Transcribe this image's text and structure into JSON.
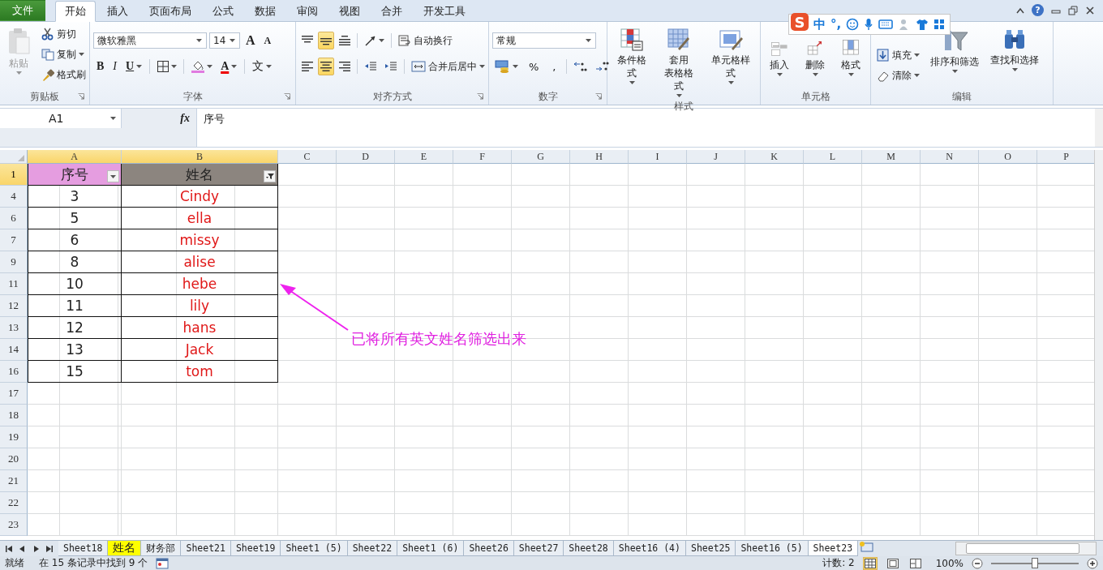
{
  "tabs": [
    {
      "label": "文件",
      "kind": "file",
      "selected": false
    },
    {
      "label": "开始",
      "kind": "tab",
      "selected": true
    },
    {
      "label": "插入",
      "kind": "tab",
      "selected": false
    },
    {
      "label": "页面布局",
      "kind": "tab",
      "selected": false
    },
    {
      "label": "公式",
      "kind": "tab",
      "selected": false
    },
    {
      "label": "数据",
      "kind": "tab",
      "selected": false
    },
    {
      "label": "审阅",
      "kind": "tab",
      "selected": false
    },
    {
      "label": "视图",
      "kind": "tab",
      "selected": false
    },
    {
      "label": "合并",
      "kind": "tab",
      "selected": false
    },
    {
      "label": "开发工具",
      "kind": "tab",
      "selected": false
    }
  ],
  "help_label": "?",
  "ime_bar": {
    "logo": "S",
    "mode": "中",
    "punct": "°,"
  },
  "ribbon": [
    {
      "title": "剪贴板",
      "stacks": [
        [
          {
            "kind": "paste",
            "label": "粘贴",
            "disabled": true
          }
        ],
        [
          {
            "kind": "cut",
            "label": "剪切"
          },
          {
            "kind": "copy",
            "label": "复制"
          },
          {
            "kind": "painter",
            "label": "格式刷"
          }
        ]
      ]
    },
    {
      "title": "字体",
      "lines": [
        [
          {
            "kind": "font",
            "value": "微软雅黑"
          },
          {
            "kind": "size",
            "value": "14"
          },
          {
            "kind": "grow",
            "label": "A"
          },
          {
            "kind": "shrink",
            "label": "A"
          }
        ],
        [
          {
            "kind": "bold",
            "label": "B"
          },
          {
            "kind": "italic",
            "label": "I"
          },
          {
            "kind": "underline",
            "label": "U"
          },
          {
            "kind": "sep"
          },
          {
            "kind": "borders"
          },
          {
            "kind": "sep"
          },
          {
            "kind": "fillcolor"
          },
          {
            "kind": "fontcolor",
            "label": "A"
          },
          {
            "kind": "sep"
          },
          {
            "kind": "phonetic",
            "label": "文"
          }
        ]
      ]
    },
    {
      "title": "对齐方式",
      "lines": [
        [
          {
            "kind": "top",
            "selected": false
          },
          {
            "kind": "middle",
            "selected": true
          },
          {
            "kind": "bottom",
            "selected": false
          },
          {
            "kind": "sep"
          },
          {
            "kind": "orient"
          },
          {
            "kind": "sep"
          },
          {
            "kind": "wrap",
            "label": "自动换行"
          }
        ],
        [
          {
            "kind": "left",
            "selected": false
          },
          {
            "kind": "center",
            "selected": true
          },
          {
            "kind": "right",
            "selected": false
          },
          {
            "kind": "sep"
          },
          {
            "kind": "outdent"
          },
          {
            "kind": "indent"
          },
          {
            "kind": "sep"
          },
          {
            "kind": "merge",
            "label": "合并后居中"
          }
        ]
      ]
    },
    {
      "title": "数字",
      "lines": [
        [
          {
            "kind": "format",
            "value": "常规"
          }
        ],
        [
          {
            "kind": "currency"
          },
          {
            "kind": "percent",
            "label": "%"
          },
          {
            "kind": "comma",
            "label": ","
          },
          {
            "kind": "sep"
          },
          {
            "kind": "incdec"
          },
          {
            "kind": "decdec"
          }
        ]
      ]
    },
    {
      "title": "样式",
      "stacks": [
        [
          {
            "kind": "conditional",
            "label": "条件格式"
          }
        ],
        [
          {
            "kind": "table",
            "label": [
              "套用",
              "表格格式"
            ]
          }
        ],
        [
          {
            "kind": "cellstyle",
            "label": "单元格样式"
          }
        ]
      ]
    },
    {
      "title": "单元格",
      "stacks": [
        [
          {
            "kind": "insert",
            "label": "插入"
          }
        ],
        [
          {
            "kind": "delete",
            "label": "删除"
          }
        ],
        [
          {
            "kind": "cellformat",
            "label": "格式"
          }
        ]
      ]
    },
    {
      "title": "编辑",
      "stacks": [
        [
          {
            "kind": "fill",
            "label": "填充"
          },
          {
            "kind": "clear",
            "label": "清除"
          }
        ],
        [
          {
            "kind": "sort",
            "label": "排序和筛选"
          }
        ],
        [
          {
            "kind": "find",
            "label": "查找和选择"
          }
        ]
      ]
    }
  ],
  "formula_bar": {
    "name_box": "A1",
    "function_label": "fx",
    "formula": "序号"
  },
  "sheet": {
    "columns": [
      {
        "label": "A",
        "selected": true
      },
      {
        "label": "B",
        "selected": true
      },
      {
        "label": "C",
        "selected": false
      },
      {
        "label": "D",
        "selected": false
      },
      {
        "label": "E",
        "selected": false
      },
      {
        "label": "F",
        "selected": false
      },
      {
        "label": "G",
        "selected": false
      },
      {
        "label": "H",
        "selected": false
      },
      {
        "label": "I",
        "selected": false
      },
      {
        "label": "J",
        "selected": false
      },
      {
        "label": "K",
        "selected": false
      },
      {
        "label": "L",
        "selected": false
      },
      {
        "label": "M",
        "selected": false
      },
      {
        "label": "N",
        "selected": false
      },
      {
        "label": "O",
        "selected": false
      },
      {
        "label": "P",
        "selected": false
      }
    ],
    "header_row": {
      "number": "1",
      "selected": true,
      "cells": [
        {
          "text": "序号",
          "color": "#e59de0",
          "filtered": false
        },
        {
          "text": "姓名",
          "color": "#8c857f",
          "filtered": true
        }
      ]
    },
    "rows": [
      {
        "number": "4",
        "cells": [
          "3",
          "Cindy"
        ]
      },
      {
        "number": "6",
        "cells": [
          "5",
          "ella"
        ]
      },
      {
        "number": "7",
        "cells": [
          "6",
          "missy"
        ]
      },
      {
        "number": "9",
        "cells": [
          "8",
          "alise"
        ]
      },
      {
        "number": "11",
        "cells": [
          "10",
          "hebe"
        ]
      },
      {
        "number": "12",
        "cells": [
          "11",
          "lily"
        ]
      },
      {
        "number": "13",
        "cells": [
          "12",
          "hans"
        ]
      },
      {
        "number": "14",
        "cells": [
          "13",
          "Jack"
        ]
      },
      {
        "number": "16",
        "cells": [
          "15",
          "tom"
        ]
      }
    ],
    "empty_rows": [
      "17",
      "18",
      "19",
      "20",
      "21",
      "22",
      "23"
    ]
  },
  "annotation": {
    "text": "已将所有英文姓名筛选出来"
  },
  "sheet_tabs": [
    {
      "label": "Sheet18",
      "selected": false
    },
    {
      "label": "姓名",
      "selected": false,
      "color": "#ffff00"
    },
    {
      "label": "财务部",
      "selected": false
    },
    {
      "label": "Sheet21",
      "selected": false
    },
    {
      "label": "Sheet19",
      "selected": false
    },
    {
      "label": "Sheet1 (5)",
      "selected": false
    },
    {
      "label": "Sheet22",
      "selected": false
    },
    {
      "label": "Sheet1 (6)",
      "selected": false
    },
    {
      "label": "Sheet26",
      "selected": false
    },
    {
      "label": "Sheet27",
      "selected": false
    },
    {
      "label": "Sheet28",
      "selected": false
    },
    {
      "label": "Sheet16 (4)",
      "selected": false
    },
    {
      "label": "Sheet25",
      "selected": false
    },
    {
      "label": "Sheet16 (5)",
      "selected": false
    },
    {
      "label": "Sheet23",
      "selected": true
    }
  ],
  "status_bar": {
    "ready": "就绪",
    "filter_info": "在 15 条记录中找到 9 个",
    "count": "计数: 2",
    "views": [
      {
        "kind": "normal",
        "selected": true
      },
      {
        "kind": "page",
        "selected": false
      },
      {
        "kind": "break",
        "selected": false
      }
    ],
    "zoom": "100%",
    "zoom_slider": {
      "level": 0.5
    }
  }
}
